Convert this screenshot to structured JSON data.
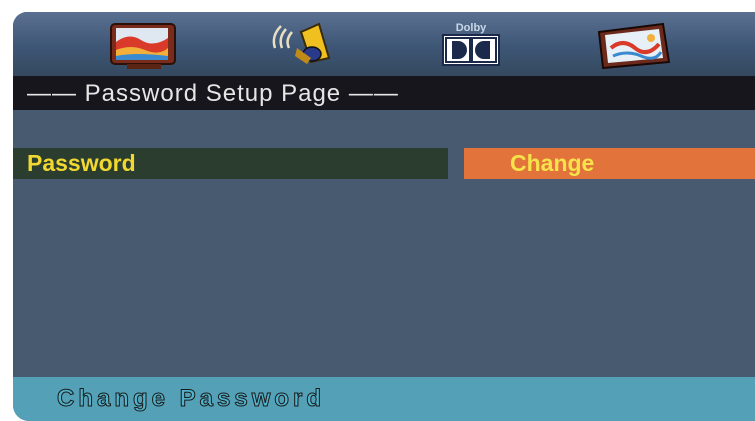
{
  "tabs": [
    {
      "icon": "general-setup-tv-icon"
    },
    {
      "icon": "audio-speaker-icon"
    },
    {
      "icon": "dolby-icon",
      "label": "Dolby"
    },
    {
      "icon": "preference-picture-icon"
    }
  ],
  "header": {
    "title": "—— Password Setup Page ——"
  },
  "settings": {
    "password": {
      "label": "Password",
      "value": "Change"
    }
  },
  "status": {
    "text": "Change Password"
  },
  "colors": {
    "selected_value_bg": "#e2733b",
    "label_text": "#f0d830",
    "status_bar": "#54a0b6"
  }
}
